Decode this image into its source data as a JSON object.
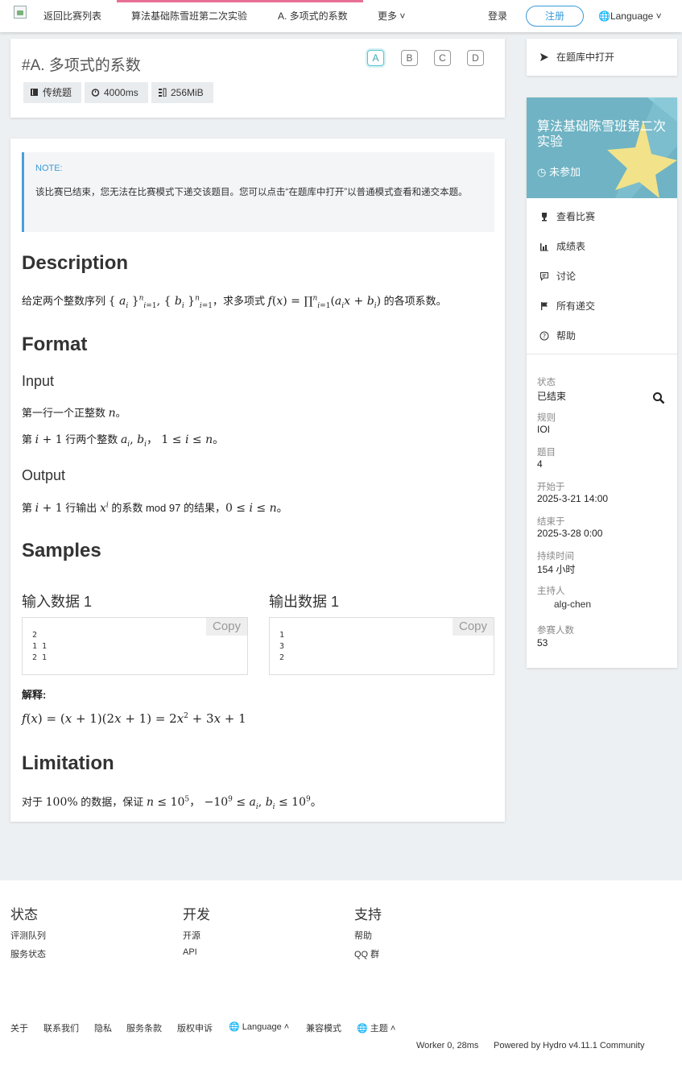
{
  "nav": {
    "back": "返回比赛列表",
    "contest": "算法基础陈雪班第二次实验",
    "problem": "A. 多项式的系数",
    "more": "更多 ˅",
    "login": "登录",
    "register": "注册",
    "language": "Language ˅"
  },
  "problem": {
    "title": "#A. 多项式的系数",
    "pills": [
      "A",
      "B",
      "C",
      "D"
    ],
    "type": "传统题",
    "time": "4000ms",
    "memory": "256MiB"
  },
  "note": {
    "heading": "NOTE:",
    "text": "该比赛已结束，您无法在比赛模式下递交该题目。您可以点击“在题库中打开”以普通模式查看和递交本题。"
  },
  "content": {
    "desc_h": "Description",
    "desc_pre": "给定两个整数序列",
    "desc_mid": "，求多项式",
    "desc_post": "的各项系数。",
    "format_h": "Format",
    "input_h": "Input",
    "input_l1_pre": "第一行一个正整数",
    "input_l1_post": "。",
    "input_l2_pre": "第",
    "input_l2_mid": "行两个整数",
    "output_h": "Output",
    "output_pre": "第",
    "output_mid1": "行输出",
    "output_mid2": "的系数 mod 97 的结果，",
    "samples_h": "Samples",
    "in_h": "输入数据 1",
    "out_h": "输出数据 1",
    "in_data": "2\n1 1\n2 1",
    "out_data": "1\n3\n2",
    "copy": "Copy",
    "explain": "解释:",
    "limit_h": "Limitation",
    "limit_pre": "对于",
    "limit_mid": "的数据，保证"
  },
  "sidebar": {
    "open_in_bank": "在题库中打开",
    "contest_title": "算法基础陈雪班第二次实验",
    "not_joined": "未参加",
    "links": [
      "查看比赛",
      "成绩表",
      "讨论",
      "所有递交",
      "帮助"
    ],
    "meta": [
      {
        "k": "状态",
        "v": "已结束"
      },
      {
        "k": "规则",
        "v": "IOI"
      },
      {
        "k": "题目",
        "v": "4"
      },
      {
        "k": "开始于",
        "v": "2025-3-21 14:00"
      },
      {
        "k": "结束于",
        "v": "2025-3-28 0:00"
      },
      {
        "k": "持续时间",
        "v": "154 小时"
      },
      {
        "k": "主持人",
        "v": "alg-chen"
      },
      {
        "k": "参赛人数",
        "v": "53"
      }
    ]
  },
  "footer": {
    "cols": [
      {
        "h": "状态",
        "links": [
          "评测队列",
          "服务状态"
        ]
      },
      {
        "h": "开发",
        "links": [
          "开源",
          "API"
        ]
      },
      {
        "h": "支持",
        "links": [
          "帮助",
          "QQ 群"
        ]
      }
    ],
    "bottom_links": [
      "关于",
      "联系我们",
      "隐私",
      "服务条款",
      "版权申诉",
      "Language ˄",
      "兼容模式",
      "主题 ˄"
    ],
    "worker": "Worker 0, 28ms",
    "powered": "Powered by Hydro v4.11.1 Community"
  },
  "colors": {
    "accent": "#3a9ad9",
    "nav_active": "#e86f94",
    "contest_banner": "#6fb3c4"
  }
}
